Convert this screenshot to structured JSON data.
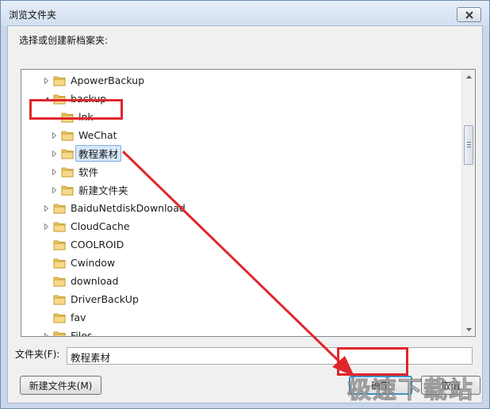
{
  "window": {
    "title": "浏览文件夹",
    "prompt": "选择或创建新档案夹:"
  },
  "tree": {
    "items": [
      {
        "label": "ApowerBackup",
        "expander": "collapsed"
      },
      {
        "label": "backup",
        "expander": "expanded"
      },
      {
        "label": "lnk",
        "expander": "none"
      },
      {
        "label": "WeChat",
        "expander": "collapsed"
      },
      {
        "label": "教程素材",
        "expander": "collapsed",
        "selected": true
      },
      {
        "label": "软件",
        "expander": "collapsed"
      },
      {
        "label": "新建文件夹",
        "expander": "collapsed"
      },
      {
        "label": "BaiduNetdiskDownload",
        "expander": "collapsed"
      },
      {
        "label": "CloudCache",
        "expander": "collapsed"
      },
      {
        "label": "COOLROID",
        "expander": "none"
      },
      {
        "label": "Cwindow",
        "expander": "none"
      },
      {
        "label": "download",
        "expander": "none"
      },
      {
        "label": "DriverBackUp",
        "expander": "none"
      },
      {
        "label": "fav",
        "expander": "none"
      },
      {
        "label": "Files",
        "expander": "collapsed"
      }
    ]
  },
  "folder": {
    "label": "文件夹(F):",
    "value": "教程素材"
  },
  "buttons": {
    "new_folder": "新建文件夹(M)",
    "ok": "确定",
    "cancel": "取消"
  },
  "watermark": "极速下载站",
  "colors": {
    "annotation_red": "#e0262b",
    "selection_fill": "#d6e8fb",
    "folder_yellow": "#e8c15a"
  }
}
